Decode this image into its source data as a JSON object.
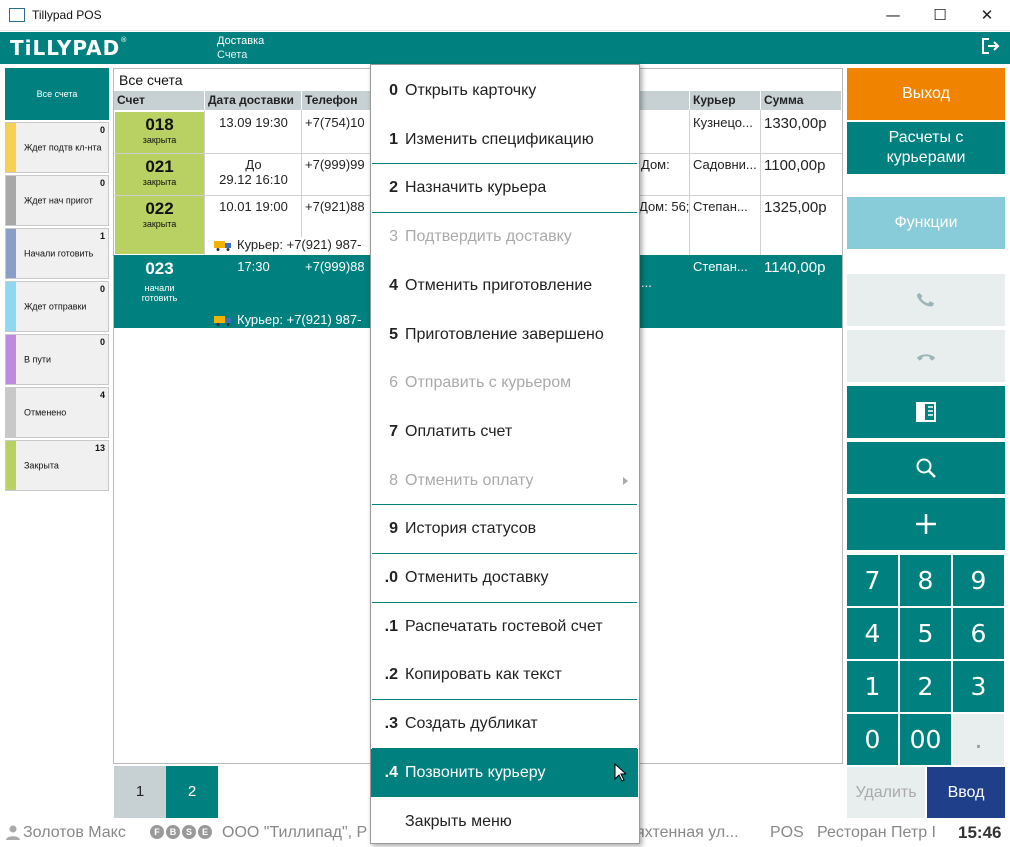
{
  "window": {
    "title": "Tillypad POS",
    "minimize": "—",
    "maximize": "☐",
    "close": "✕"
  },
  "header": {
    "logo": "TiLLYPAD",
    "logo_mark": "®",
    "module": "Доставка",
    "section": "Счета"
  },
  "sidebar": {
    "all": "Все счета",
    "items": [
      {
        "label": "Ждет подтв кл-нта",
        "count": "0",
        "color": "#f7d054"
      },
      {
        "label": "Ждет нач пригот",
        "count": "0",
        "color": "#a8a8a8"
      },
      {
        "label": "Начали готовить",
        "count": "1",
        "color": "#8a9fc8"
      },
      {
        "label": "Ждет отправки",
        "count": "0",
        "color": "#8fd8f2"
      },
      {
        "label": "В пути",
        "count": "0",
        "color": "#c08ae0"
      },
      {
        "label": "Отменено",
        "count": "4",
        "color": "#c8c8c8"
      },
      {
        "label": "Закрыта",
        "count": "13",
        "color": "#b9d162"
      }
    ]
  },
  "table": {
    "title": "Все счета",
    "columns": [
      "Счет",
      "Дата доставки",
      "Телефон",
      "Курьер",
      "Сумма"
    ],
    "rows": [
      {
        "num": "018",
        "status": "закрыта",
        "date": "13.09 19:30",
        "phone": "+7(754)10",
        "addr": "",
        "courier": "Кузнецо...",
        "sum": "1330,00р"
      },
      {
        "num": "021",
        "status": "закрыта",
        "date1": "До",
        "date2": "29.12 16:10",
        "phone": "+7(999)99",
        "addr": "Дом:",
        "courier": "Садовни...",
        "sum": "1100,00р"
      },
      {
        "num": "022",
        "status": "закрыта",
        "date": "10.01 19:00",
        "phone": "+7(921)88",
        "addr": "Дом: 56;",
        "courier": "Степан...",
        "sum": "1325,00р",
        "courier_line": "Курьер: +7(921) 987-"
      },
      {
        "num": "023",
        "status1": "начали",
        "status2": "готовить",
        "date": "17:30",
        "phone": "+7(999)88",
        "addr": "...",
        "courier": "Степан...",
        "sum": "1140,00р",
        "courier_line": "Курьер: +7(921) 987-"
      }
    ]
  },
  "pager": {
    "pages": [
      "1",
      "2"
    ]
  },
  "right": {
    "exit": "Выход",
    "couriers": "Расчеты с курьерами",
    "functions": "Функции",
    "keypad": [
      "7",
      "8",
      "9",
      "4",
      "5",
      "6",
      "1",
      "2",
      "3",
      "0",
      "00",
      "."
    ],
    "delete": "Удалить",
    "enter": "Ввод",
    "colors": {
      "exit": "#f08300",
      "teal": "#00807e",
      "functions": "#87ccd8",
      "enter": "#1f3f8a"
    }
  },
  "status": {
    "user": "Золотов Макс",
    "badges": [
      "F",
      "B",
      "S",
      "E"
    ],
    "org": "ООО \"Тиллипад\", Р",
    "addr": "яхтенная ул...",
    "mode": "POS",
    "place": "Ресторан Петр I",
    "time": "15:46"
  },
  "menu": {
    "items": [
      {
        "key": "0",
        "label": "Открыть карточку",
        "disabled": false
      },
      {
        "key": "1",
        "label": "Изменить спецификацию",
        "disabled": false
      },
      {
        "key": "2",
        "label": "Назначить курьера",
        "disabled": false
      },
      {
        "key": "3",
        "label": "Подтвердить доставку",
        "disabled": true
      },
      {
        "key": "4",
        "label": "Отменить приготовление",
        "disabled": false
      },
      {
        "key": "5",
        "label": "Приготовление завершено",
        "disabled": false
      },
      {
        "key": "6",
        "label": "Отправить с курьером",
        "disabled": true
      },
      {
        "key": "7",
        "label": "Оплатить счет",
        "disabled": false
      },
      {
        "key": "8",
        "label": "Отменить оплату",
        "disabled": true
      },
      {
        "key": "9",
        "label": "История статусов",
        "disabled": false
      },
      {
        "key": ".0",
        "label": "Отменить доставку",
        "disabled": false
      },
      {
        "key": ".1",
        "label": "Распечатать гостевой счет",
        "disabled": false
      },
      {
        "key": ".2",
        "label": "Копировать как текст",
        "disabled": false
      },
      {
        "key": ".3",
        "label": "Создать дубликат",
        "disabled": false
      },
      {
        "key": ".4",
        "label": "Позвонить курьеру",
        "disabled": false,
        "highlighted": true
      },
      {
        "key": "",
        "label": "Закрыть меню",
        "disabled": false
      }
    ]
  }
}
